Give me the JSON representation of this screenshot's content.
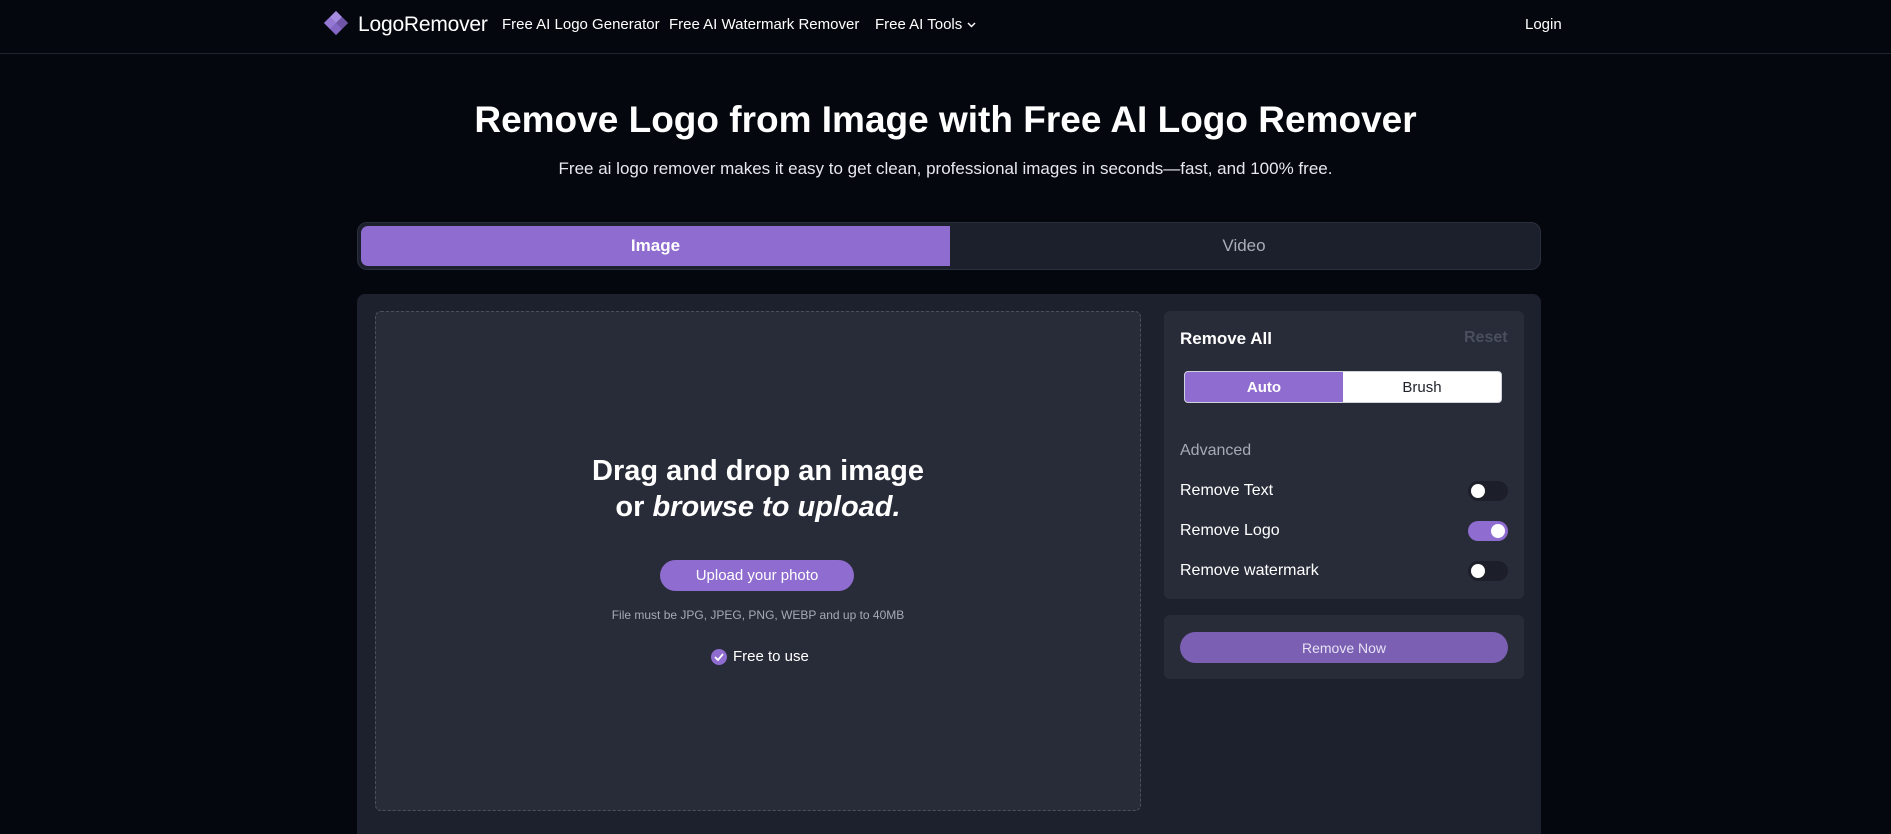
{
  "brand": {
    "name": "LogoRemover",
    "icon": "diamond-logo-icon"
  },
  "nav": {
    "items": [
      {
        "label": "Free AI Logo Generator"
      },
      {
        "label": "Free AI Watermark Remover"
      },
      {
        "label": "Free AI Tools",
        "has_dropdown": true
      }
    ],
    "login_label": "Login"
  },
  "hero": {
    "title": "Remove Logo from Image with Free AI Logo Remover",
    "subtitle": "Free ai logo remover makes it easy to get clean, professional images in seconds—fast, and 100% free."
  },
  "tabs": [
    {
      "label": "Image",
      "active": true
    },
    {
      "label": "Video",
      "active": false
    }
  ],
  "dropzone": {
    "line1": "Drag and drop an image",
    "line2_prefix": "or ",
    "line2_emphasis": "browse to upload.",
    "upload_label": "Upload your photo",
    "file_note": "File must be JPG, JPEG, PNG, WEBP and up to 40MB",
    "free_label": "Free to use"
  },
  "settings": {
    "title": "Remove All",
    "reset_label": "Reset",
    "modes": [
      {
        "label": "Auto",
        "active": true
      },
      {
        "label": "Brush",
        "active": false
      }
    ],
    "advanced_label": "Advanced",
    "options": [
      {
        "label": "Remove Text",
        "enabled": false
      },
      {
        "label": "Remove Logo",
        "enabled": true
      },
      {
        "label": "Remove watermark",
        "enabled": false
      }
    ]
  },
  "action": {
    "remove_now_label": "Remove Now"
  },
  "colors": {
    "accent": "#8f6ccf",
    "background": "#05070f",
    "panel": "#282c38",
    "card": "#1d212d"
  }
}
